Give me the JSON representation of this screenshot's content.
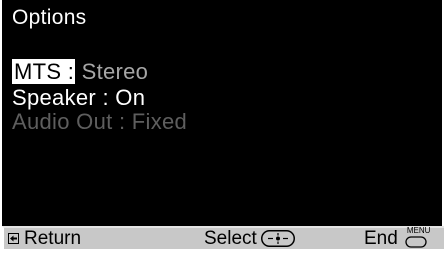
{
  "menu": {
    "title": "Options",
    "items": [
      {
        "label": "MTS :",
        "value": "Stereo",
        "state": "selected"
      },
      {
        "label": "Speaker :",
        "value": "On",
        "state": "normal"
      },
      {
        "label": "Audio Out :",
        "value": "Fixed",
        "state": "disabled"
      }
    ]
  },
  "footer": {
    "return_label": "Return",
    "select_label": "Select",
    "end_label": "End",
    "menu_key_label": "MENU",
    "return_icon": "return-arrow-icon",
    "select_icon": "joystick-icon",
    "end_icon": "menu-button-icon"
  },
  "colors": {
    "background": "#000000",
    "text": "#ffffff",
    "value_text": "#a6a6a6",
    "disabled_text": "#5e5e5e",
    "highlight_bg": "#ffffff",
    "footer_bg": "#c8c8c8"
  }
}
